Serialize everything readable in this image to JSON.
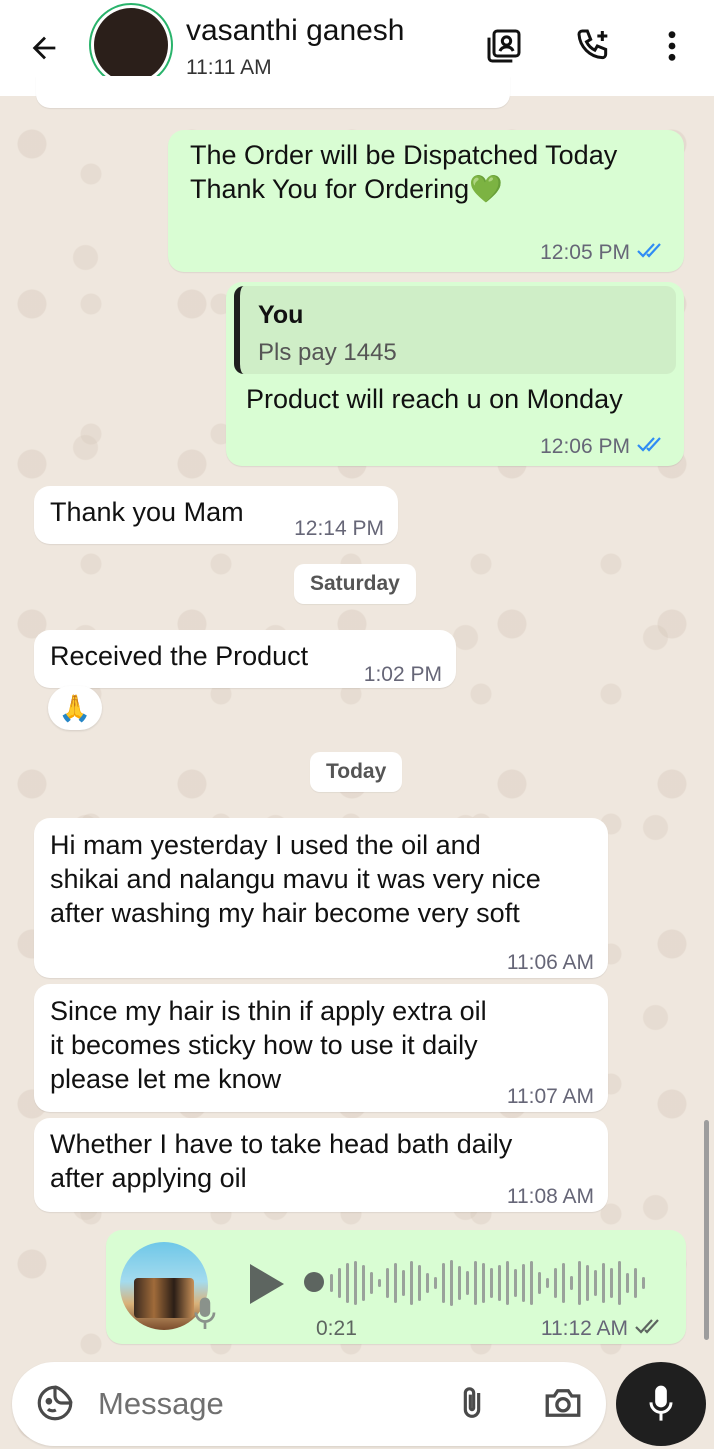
{
  "header": {
    "contact_name": "vasanthi ganesh",
    "last_seen": "11:11 AM"
  },
  "messages": {
    "m1": {
      "line1": "The Order will be Dispatched Today",
      "line2": "Thank You for Ordering",
      "emoji": "💚",
      "time": "12:05 PM"
    },
    "m2": {
      "quote_author": "You",
      "quote_text": "Pls pay 1445",
      "text": "Product will reach u on Monday",
      "time": "12:06 PM"
    },
    "m3": {
      "text": "Thank you Mam",
      "time": "12:14 PM"
    },
    "date1": "Saturday",
    "m4": {
      "text": "Received the Product",
      "time": "1:02 PM",
      "reaction": "🙏"
    },
    "date2": "Today",
    "m5": {
      "line1": "Hi mam yesterday I used the oil and",
      "line2": "shikai and nalangu mavu it was very nice",
      "line3": "after washing my hair become very soft",
      "time": "11:06 AM"
    },
    "m6": {
      "line1": "Since my hair is thin if apply extra oil",
      "line2": "it becomes sticky how to use it daily",
      "line3": "please let me know",
      "time": "11:07 AM"
    },
    "m7": {
      "line1": "Whether I have to take head bath daily",
      "line2": "after applying oil",
      "time": "11:08 AM"
    },
    "voice": {
      "duration": "0:21",
      "time": "11:12 AM"
    }
  },
  "composer": {
    "placeholder": "Message"
  },
  "colors": {
    "outgoing_bubble": "#d9fdd3",
    "incoming_bubble": "#ffffff",
    "read_ticks": "#2f8cf4",
    "wallpaper": "#efe7de"
  }
}
